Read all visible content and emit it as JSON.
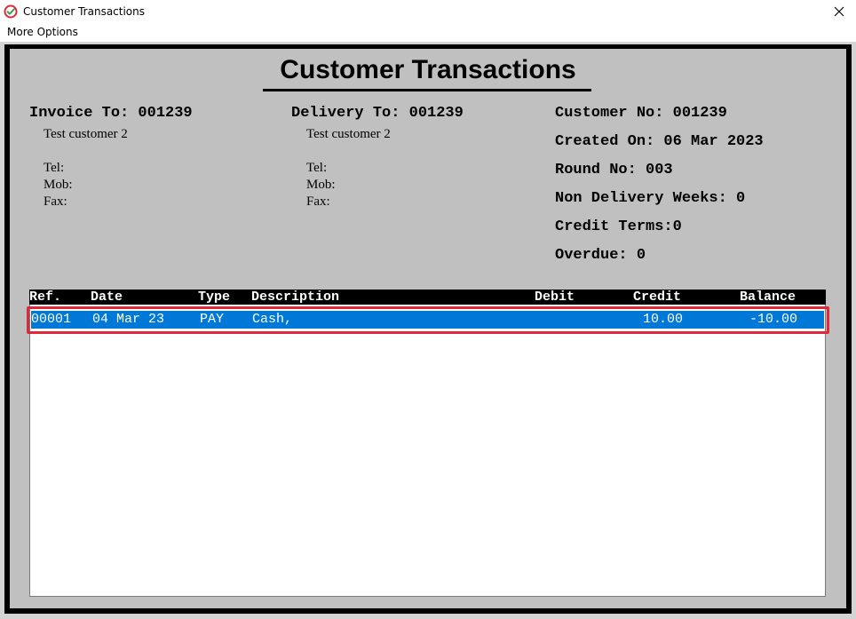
{
  "window": {
    "title": "Customer Transactions",
    "icon": "app-check-icon",
    "close_icon": "close-icon"
  },
  "menu": {
    "items": [
      "More Options"
    ]
  },
  "page": {
    "title": "Customer Transactions"
  },
  "invoice": {
    "heading": "Invoice To: 001239",
    "name": "Test customer 2",
    "tel": "Tel:",
    "mob": "Mob:",
    "fax": "Fax:"
  },
  "delivery": {
    "heading": "Delivery To: 001239",
    "name": "Test customer 2",
    "tel": "Tel:",
    "mob": "Mob:",
    "fax": "Fax:"
  },
  "customer": {
    "customer_no": "Customer No: 001239",
    "created_on": "Created On: 06 Mar 2023",
    "round_no": "Round No: 003",
    "non_delivery_weeks": "Non Delivery Weeks: 0",
    "credit_terms": "Credit Terms:0",
    "overdue": "Overdue: 0"
  },
  "table": {
    "columns": [
      "Ref.",
      "Date",
      "Type",
      "Description",
      "Debit",
      "Credit",
      "Balance"
    ],
    "rows": [
      {
        "ref": "00001",
        "date": "04 Mar 23",
        "type": "PAY",
        "description": "Cash,",
        "debit": "",
        "credit": "10.00",
        "balance": "-10.00",
        "selected": true
      }
    ]
  },
  "colors": {
    "selection": "#0078d7",
    "highlight_border": "#e0283c",
    "panel": "#c0c0c0"
  }
}
